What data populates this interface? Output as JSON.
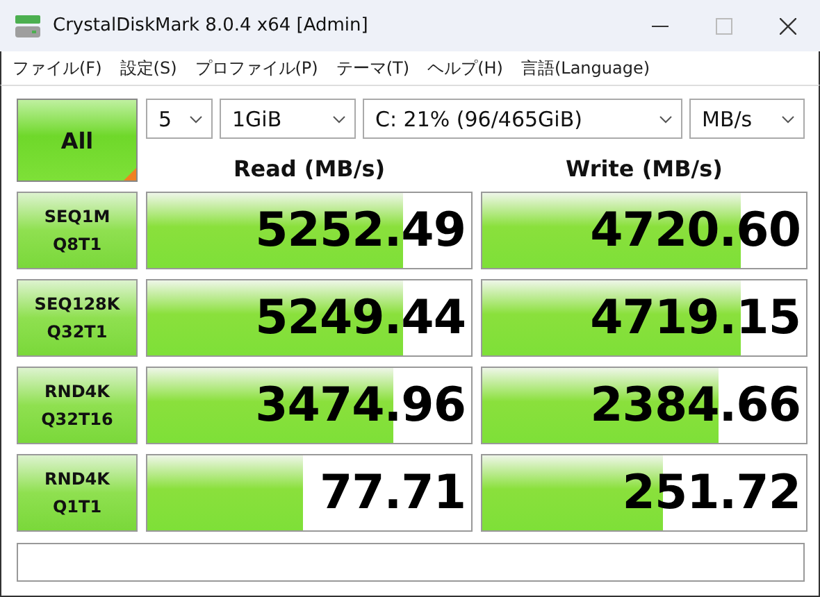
{
  "window": {
    "title": "CrystalDiskMark 8.0.4 x64 [Admin]"
  },
  "menu": [
    "ファイル(F)",
    "設定(S)",
    "プロファイル(P)",
    "テーマ(T)",
    "ヘルプ(H)",
    "言語(Language)"
  ],
  "all_button": {
    "label": "All"
  },
  "selectors": [
    {
      "value": "5"
    },
    {
      "value": "1GiB"
    },
    {
      "value": "C: 21% (96/465GiB)"
    },
    {
      "value": "MB/s"
    }
  ],
  "columns": [
    "Read (MB/s)",
    "Write (MB/s)"
  ],
  "tests": [
    {
      "label": [
        "SEQ1M",
        "Q8T1"
      ],
      "read": {
        "reading": "5252.49",
        "level": 0.79
      },
      "write": {
        "reading": "4720.60",
        "level": 0.8
      }
    },
    {
      "label": [
        "SEQ128K",
        "Q32T1"
      ],
      "read": {
        "reading": "5249.44",
        "level": 0.79
      },
      "write": {
        "reading": "4719.15",
        "level": 0.8
      }
    },
    {
      "label": [
        "RND4K",
        "Q32T16"
      ],
      "read": {
        "reading": "3474.96",
        "level": 0.76
      },
      "write": {
        "reading": "2384.66",
        "level": 0.73
      }
    },
    {
      "label": [
        "RND4K",
        "Q1T1"
      ],
      "read": {
        "reading": "77.71",
        "level": 0.48
      },
      "write": {
        "reading": "251.72",
        "level": 0.56
      }
    }
  ]
}
